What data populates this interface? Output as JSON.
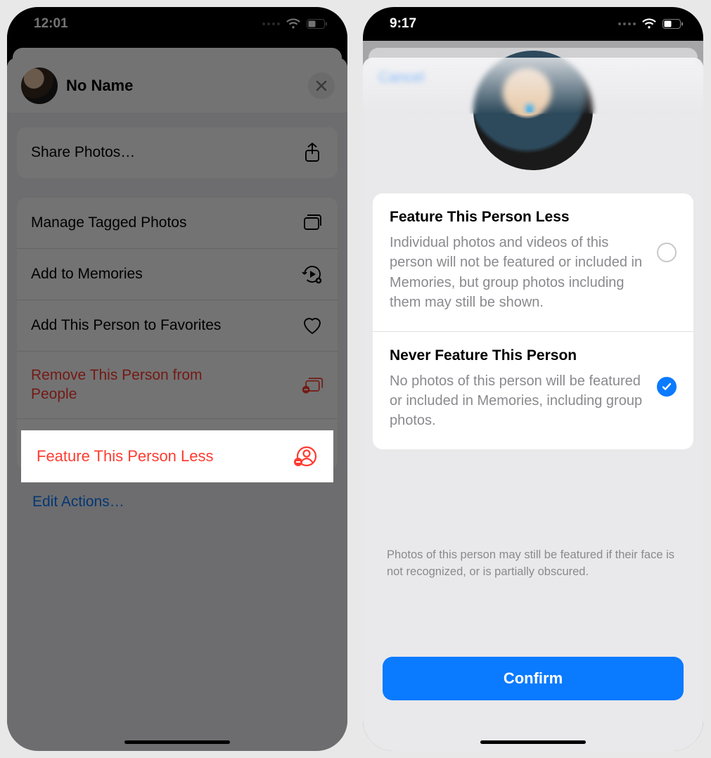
{
  "phone1": {
    "status": {
      "time": "12:01"
    },
    "person_name": "No Name",
    "menu": {
      "share": "Share Photos…",
      "manage": "Manage Tagged Photos",
      "add_memories": "Add to Memories",
      "add_favorites": "Add This Person to Favorites",
      "remove": "Remove This Person from People",
      "feature_less": "Feature This Person Less",
      "edit": "Edit Actions…"
    }
  },
  "phone2": {
    "status": {
      "time": "9:17"
    },
    "cancel": "Cancel",
    "option1": {
      "title": "Feature This Person Less",
      "desc": "Individual photos and videos of this person will not be featured or included in Memories, but group photos including them may still be shown."
    },
    "option2": {
      "title": "Never Feature This Person",
      "desc": "No photos of this person will be featured or included in Memories, including group photos."
    },
    "footnote": "Photos of this person may still be featured if their face is not recognized, or is partially obscured.",
    "confirm": "Confirm"
  }
}
